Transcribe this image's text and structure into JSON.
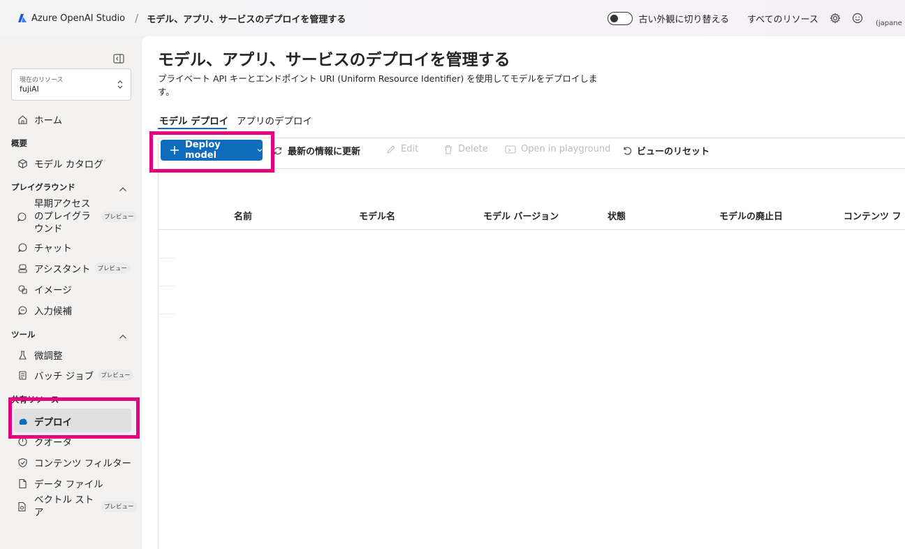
{
  "topbar": {
    "app_name": "Azure OpenAI Studio",
    "breadcrumb_separator": "/",
    "page_crumb": "モデル、アプリ、サービスのデプロイを管理する",
    "toggle_label": "古い外観に切り替える",
    "all_resources": "すべてのリソース",
    "user": "(japane",
    "icons": [
      "settings-icon",
      "smiley-icon"
    ]
  },
  "sidebar": {
    "resource_label": "現在のリソース",
    "resource_value": "fujiAI",
    "home": "ホーム",
    "section_overview": "概要",
    "model_catalog": "モデル カタログ",
    "section_playground": "プレイグラウンド",
    "early_access": "早期アクセスのプレイグラウンド",
    "chat": "チャット",
    "assistant": "アシスタント",
    "image": "イメージ",
    "completions": "入力候補",
    "section_tools": "ツール",
    "fine_tuning": "微調整",
    "batch_jobs": "バッチ ジョブ",
    "section_shared": "共有リソース",
    "deployments": "デプロイ",
    "quota": "クオータ",
    "content_filters": "コンテンツ フィルター",
    "data_files": "データ ファイル",
    "vector_store": "ベクトル ストア",
    "preview_badge": "プレビュー"
  },
  "main": {
    "title": "モデル、アプリ、サービスのデプロイを管理する",
    "description": "プライベート API キーとエンドポイント URI (Uniform Resource Identifier) を使用してモデルをデプロイします。",
    "tabs": [
      {
        "label": "モデル デプロイ",
        "active": true
      },
      {
        "label": "アプリのデプロイ",
        "active": false
      }
    ],
    "toolbar": {
      "deploy_model": "Deploy model",
      "refresh": "最新の情報に更新",
      "edit": "Edit",
      "delete": "Delete",
      "open_playground": "Open in playground",
      "reset_view": "ビューのリセット"
    },
    "table": {
      "columns": [
        "名前",
        "モデル名",
        "モデル バージョン",
        "状態",
        "モデルの廃止日",
        "コンテンツ フ"
      ]
    }
  },
  "colors": {
    "accent": "#0f6cbd",
    "highlight": "#e4007f"
  }
}
